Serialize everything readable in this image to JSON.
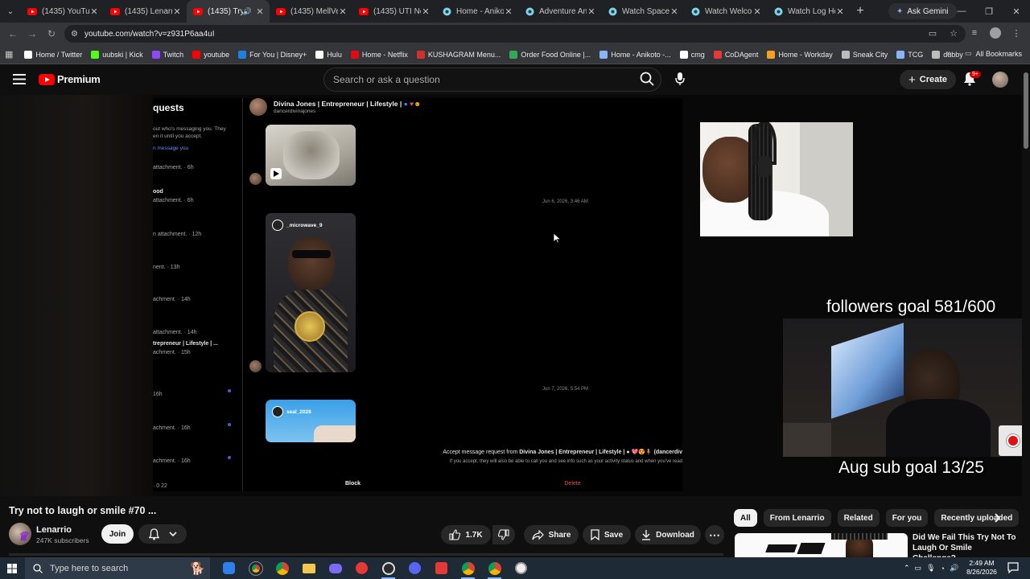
{
  "browser": {
    "tabs": [
      {
        "title": "(1435) YouTube",
        "favicon": "youtube-icon",
        "active": false
      },
      {
        "title": "(1435) Lenarrio",
        "favicon": "youtube-icon",
        "active": false
      },
      {
        "title": "(1435) Try n",
        "favicon": "youtube-icon",
        "active": true
      },
      {
        "title": "(1435) MellVen",
        "favicon": "youtube-icon",
        "active": false
      },
      {
        "title": "(1435) UTI Nos",
        "favicon": "youtube-icon",
        "active": false
      },
      {
        "title": "Home - Anikoto",
        "favicon": "anikoto-icon",
        "active": false
      },
      {
        "title": "Adventure Ani",
        "favicon": "anikoto-icon",
        "active": false
      },
      {
        "title": "Watch Space P",
        "favicon": "anikoto-icon",
        "active": false
      },
      {
        "title": "Watch Welcom",
        "favicon": "anikoto-icon",
        "active": false
      },
      {
        "title": "Watch Log Hor",
        "favicon": "anikoto-icon",
        "active": false
      }
    ],
    "gemini_label": "Ask Gemini",
    "url": "youtube.com/watch?v=z931P6aa4uI",
    "bookmarks": [
      {
        "label": "Home / Twitter",
        "color": "#ffffff"
      },
      {
        "label": "uubski | Kick",
        "color": "#53fc18"
      },
      {
        "label": "Twitch",
        "color": "#9146ff"
      },
      {
        "label": "youtube",
        "color": "#ff0000"
      },
      {
        "label": "For You | Disney+",
        "color": "#1f80e0"
      },
      {
        "label": "Hulu",
        "color": "#ffffff"
      },
      {
        "label": "Home - Netflix",
        "color": "#e50914"
      },
      {
        "label": "KUSHAGRAM Menu...",
        "color": "#d32f2f"
      },
      {
        "label": "Order Food Online |...",
        "color": "#34a853"
      },
      {
        "label": "Home - Anikoto -...",
        "color": "#8ab4f8"
      },
      {
        "label": "cmg",
        "color": "#ffffff"
      },
      {
        "label": "CoDAgent",
        "color": "#e53935"
      },
      {
        "label": "Home - Workday",
        "color": "#f4a024"
      },
      {
        "label": "Sneak City",
        "color": "#bdbdbd"
      },
      {
        "label": "TCG",
        "color": "#8ab4f8"
      },
      {
        "label": "dubby",
        "color": "#bdbdbd"
      }
    ],
    "all_bookmarks": "All Bookmarks"
  },
  "youtube": {
    "logo_text": "Premium",
    "search_placeholder": "Search or ask a question",
    "create_label": "Create",
    "notif_count": "9+"
  },
  "video_content": {
    "requests_heading": "quests",
    "requests_sub1": "out who's messaging you. They",
    "requests_sub2": "en it until you accept.",
    "requests_link": "n message you",
    "request_items": [
      {
        "name": "",
        "text": "attachment. · 6h"
      },
      {
        "name": "ood",
        "text": ""
      },
      {
        "name": "",
        "text": "attachment. · 6h"
      },
      {
        "name": "",
        "text": "n attachment. · 12h"
      },
      {
        "name": "",
        "text": "nent. · 13h"
      },
      {
        "name": "",
        "text": "achment. · 14h"
      },
      {
        "name": "",
        "text": "attachment. · 14h"
      },
      {
        "name": "trepreneur | Lifestyle | ...",
        "text": "achment. · 15h"
      },
      {
        "name": "",
        "text": "16h"
      },
      {
        "name": "",
        "text": "achment. · 16h"
      },
      {
        "name": "",
        "text": "achment. · 16h"
      },
      {
        "name": "",
        "text": "· 0 22"
      }
    ],
    "chat_name": "Divina Jones | Entrepreneur | Lifestyle |",
    "chat_handle": "dancerdivinajones",
    "time1": "Jun 6, 2026, 3:46 AM",
    "time2": "Jun 7, 2026, 5:54 PM",
    "card1_user": "_microwave_9",
    "card2_user": "seal_2028",
    "accept_line_prefix": "Accept message request from ",
    "accept_line_name": "Divina Jones | Entrepreneur | Lifestyle | ● 💖😍🧍 (dancerdiv",
    "accept_sub": "If you accept, they will also be able to call you and see info such as your activity status and when you've read",
    "block_label": "Block",
    "delete_label": "Delete",
    "followers_goal": "followers goal 581/600",
    "sub_goal": "Aug sub goal 13/25"
  },
  "below_video": {
    "title": "Try not to laugh or smile #70 ...",
    "channel_name": "Lenarrio",
    "subscribers": "247K subscribers",
    "join_label": "Join",
    "likes": "1.7K",
    "share_label": "Share",
    "save_label": "Save",
    "download_label": "Download"
  },
  "chips": [
    "All",
    "From Lenarrio",
    "Related",
    "For you",
    "Recently uploaded"
  ],
  "recommendation": {
    "title": "Did We Fail This Try Not To Laugh Or Smile Challenge?"
  },
  "taskbar": {
    "search_placeholder": "Type here to search",
    "time": "2:49 AM",
    "date": "8/26/2026"
  },
  "colors": {
    "youtube_red": "#ff0000",
    "background": "#0f0f0f",
    "ig_link_blue": "#6f8cff",
    "delete_red": "#ed4956"
  }
}
